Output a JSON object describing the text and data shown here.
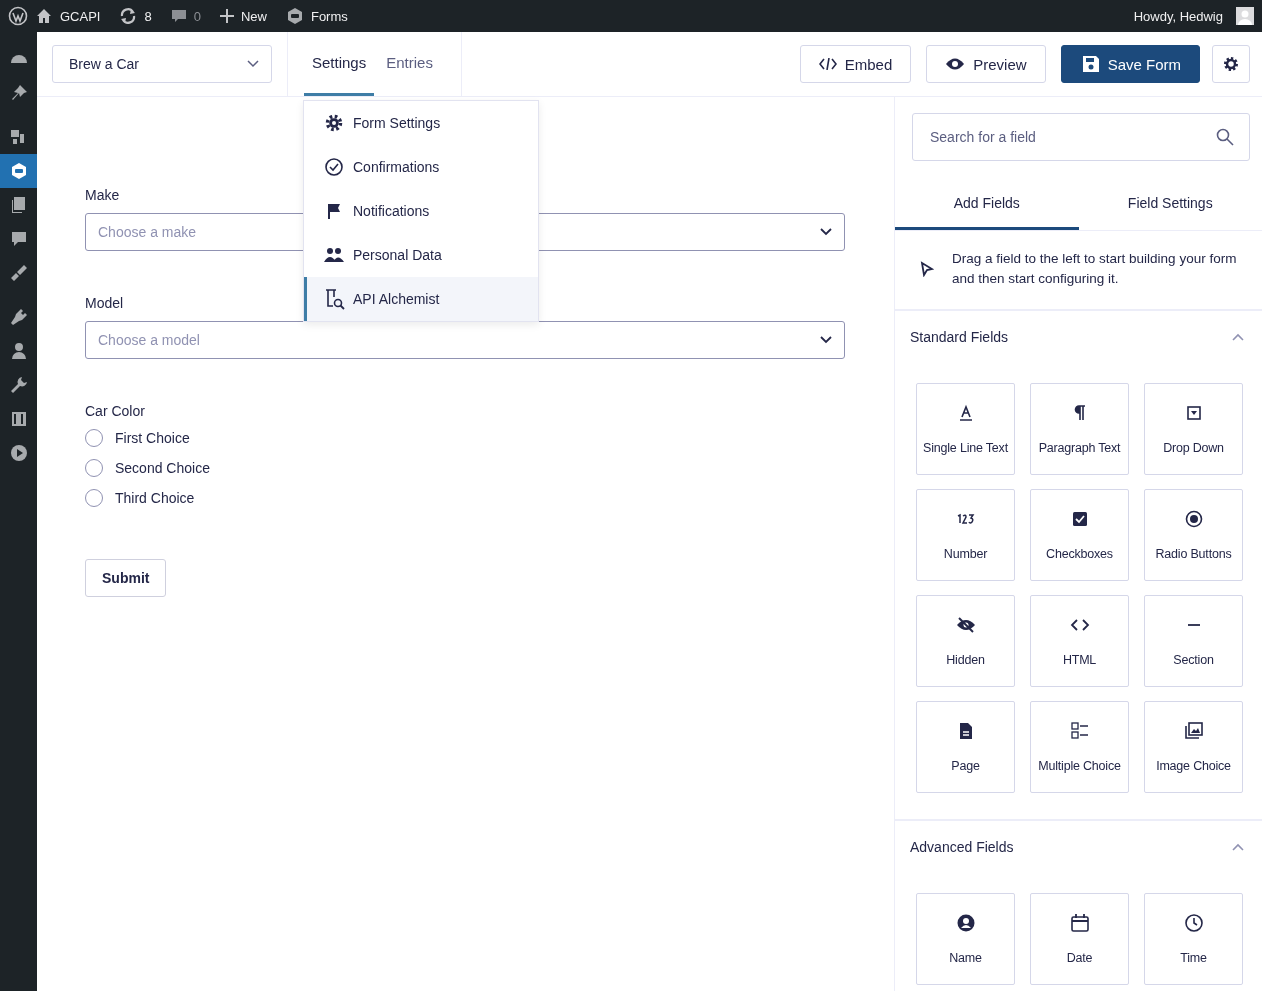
{
  "admin_bar": {
    "site": "GCAPI",
    "updates": "8",
    "comments": "0",
    "new": "New",
    "forms": "Forms",
    "greeting": "Howdy, Hedwig"
  },
  "sidebar": {
    "items": [
      {
        "selected": false
      },
      {
        "selected": false
      },
      {
        "selected": false
      },
      {
        "selected": true
      },
      {
        "selected": false
      },
      {
        "selected": false
      },
      {
        "selected": false
      },
      {
        "selected": false
      },
      {
        "selected": false
      },
      {
        "selected": false
      },
      {
        "selected": false
      },
      {
        "selected": false
      }
    ]
  },
  "toolbar": {
    "form_name": "Brew a Car",
    "tabs": [
      {
        "label": "Settings",
        "selected": true
      },
      {
        "label": "Entries",
        "selected": false
      }
    ],
    "embed": "Embed",
    "preview": "Preview",
    "save": "Save Form"
  },
  "settings_menu": [
    {
      "label": "Form Settings",
      "selected": false
    },
    {
      "label": "Confirmations",
      "selected": false
    },
    {
      "label": "Notifications",
      "selected": false
    },
    {
      "label": "Personal Data",
      "selected": false
    },
    {
      "label": "API Alchemist",
      "selected": true
    }
  ],
  "form": {
    "fields": [
      {
        "kind": "select",
        "label": "Make",
        "placeholder": "Choose a make"
      },
      {
        "kind": "select",
        "label": "Model",
        "placeholder": "Choose a model"
      },
      {
        "kind": "radio",
        "label": "Car Color",
        "choices": [
          {
            "label": "First Choice",
            "checked": false
          },
          {
            "label": "Second Choice",
            "checked": false
          },
          {
            "label": "Third Choice",
            "checked": false
          }
        ]
      }
    ],
    "submit": "Submit"
  },
  "field_panel": {
    "search": {
      "placeholder": "Search for a field"
    },
    "tabs": [
      {
        "label": "Add Fields",
        "selected": true
      },
      {
        "label": "Field Settings",
        "selected": false
      }
    ],
    "hint": "Drag a field to the left to start building your form and then start configuring it.",
    "sections": [
      {
        "title": "Standard Fields",
        "expanded": true,
        "fields": [
          "Single Line Text",
          "Paragraph Text",
          "Drop Down",
          "Number",
          "Checkboxes",
          "Radio Buttons",
          "Hidden",
          "HTML",
          "Section",
          "Page",
          "Multiple Choice",
          "Image Choice"
        ]
      },
      {
        "title": "Advanced Fields",
        "expanded": true,
        "fields": [
          "Name",
          "Date",
          "Time"
        ]
      }
    ]
  }
}
